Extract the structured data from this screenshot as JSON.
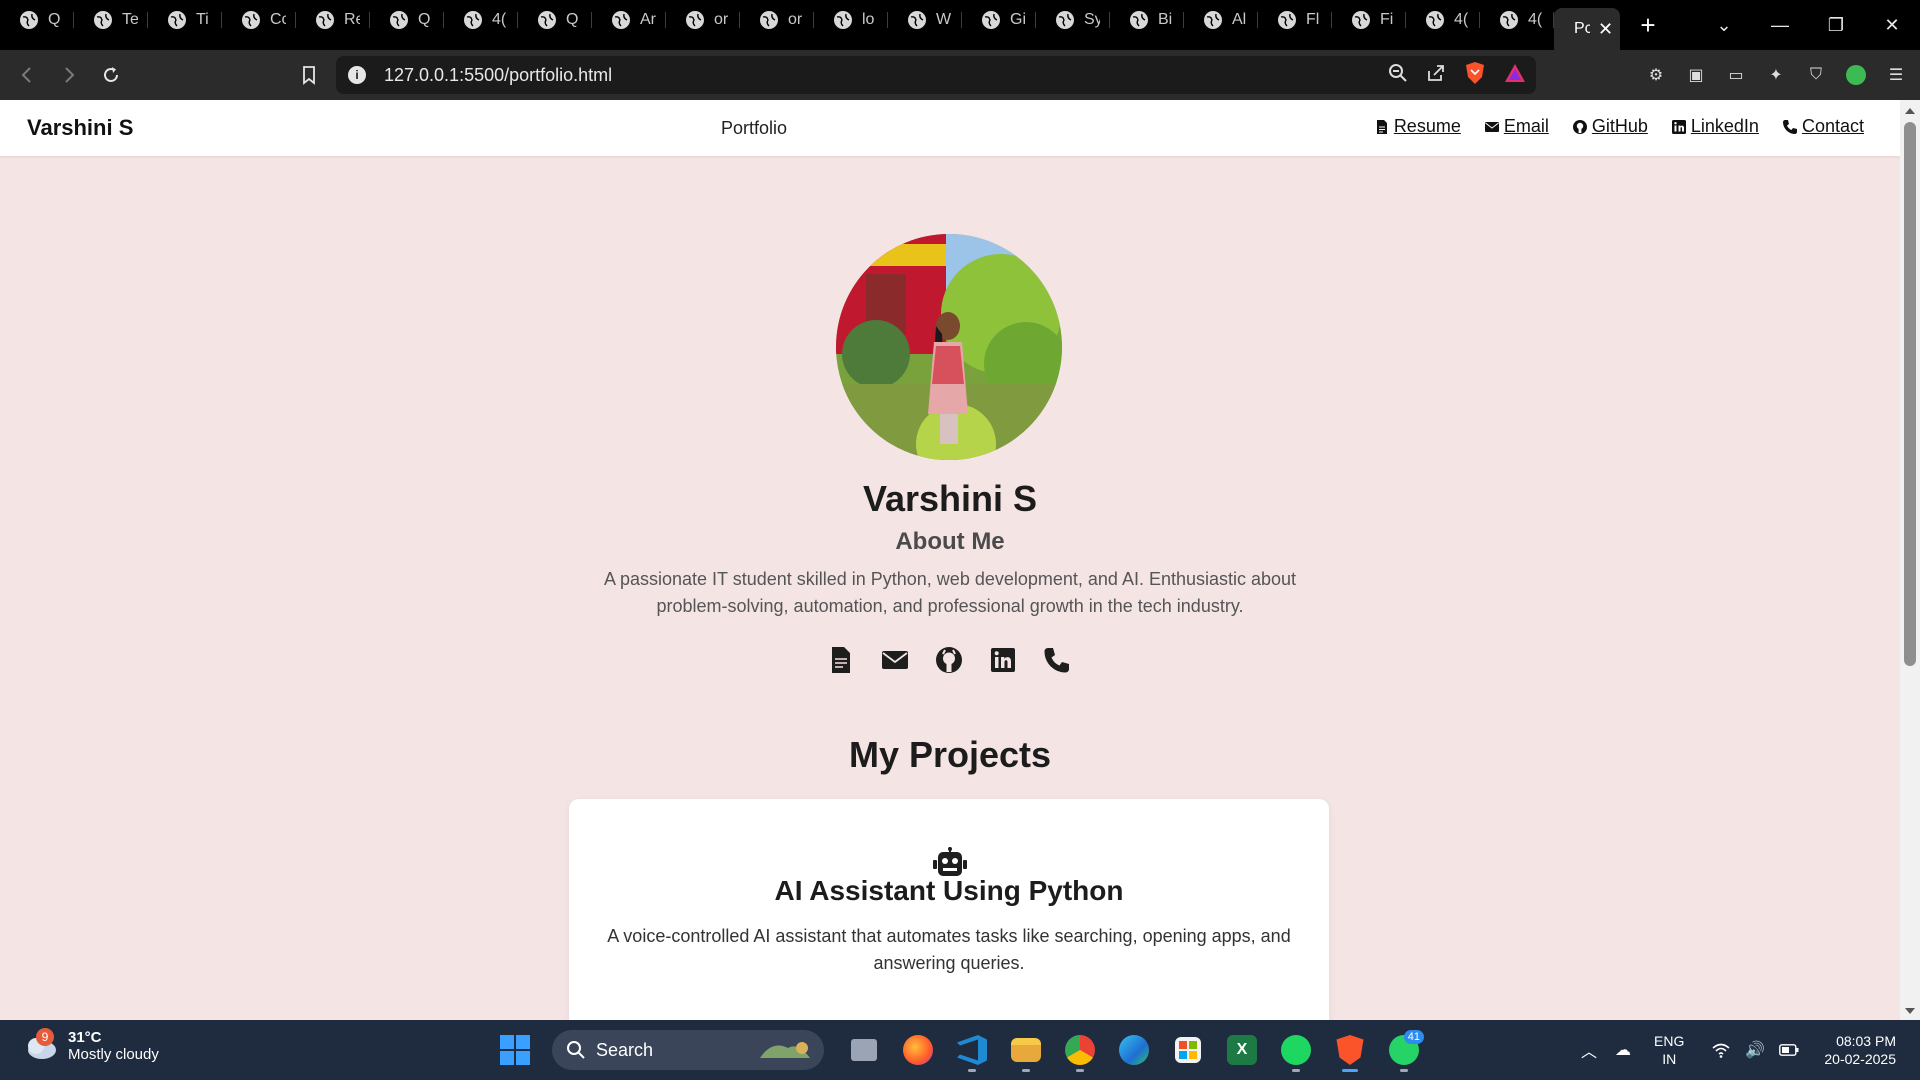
{
  "browser": {
    "tabs": [
      {
        "label": "Q"
      },
      {
        "label": "Te"
      },
      {
        "label": "Ti"
      },
      {
        "label": "Cc"
      },
      {
        "label": "Re"
      },
      {
        "label": "Q"
      },
      {
        "label": "4("
      },
      {
        "label": "Q"
      },
      {
        "label": "Ar"
      },
      {
        "label": "or"
      },
      {
        "label": "or"
      },
      {
        "label": "lo"
      },
      {
        "label": "W"
      },
      {
        "label": "Gi"
      },
      {
        "label": "Sy"
      },
      {
        "label": "Bi"
      },
      {
        "label": "Al"
      },
      {
        "label": "Fl"
      },
      {
        "label": "Fi"
      },
      {
        "label": "4("
      },
      {
        "label": "4("
      }
    ],
    "active_tab": {
      "label": "Pc"
    },
    "new_tab": "+",
    "url": "127.0.0.1:5500/portfolio.html"
  },
  "site": {
    "brand": "Varshini S",
    "nav_center": "Portfolio",
    "nav_links": {
      "resume": "Resume",
      "email": "Email",
      "github": "GitHub",
      "linkedin": "LinkedIn",
      "contact": "Contact"
    },
    "name": "Varshini S",
    "about_heading": "About Me",
    "about_text": "A passionate IT student skilled in Python, web development, and AI. Enthusiastic about problem-solving, automation, and professional growth in the tech industry.",
    "projects_heading": "My Projects",
    "project": {
      "title": "AI Assistant Using Python",
      "description": "A voice-controlled AI assistant that automates tasks like searching, opening apps, and answering queries."
    }
  },
  "taskbar": {
    "weather_badge": "9",
    "temperature": "31°C",
    "condition": "Mostly cloudy",
    "search": "Search",
    "whatsapp_count": "41",
    "lang_line1": "ENG",
    "lang_line2": "IN",
    "time": "08:03 PM",
    "date": "20-02-2025"
  },
  "colors": {
    "page_bg": "#f5e4e4",
    "taskbar": "#1f2b3f",
    "browser_chrome": "#2b2b2b"
  }
}
